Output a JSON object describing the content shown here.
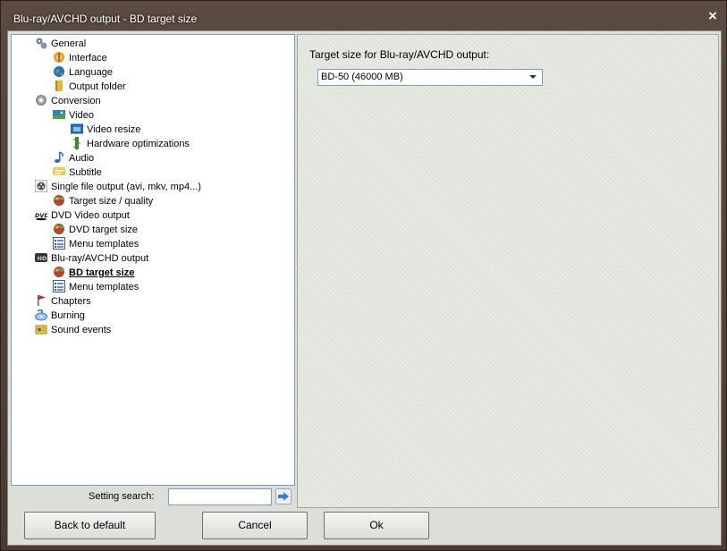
{
  "window": {
    "title": "Blu-ray/AVCHD output - BD target size",
    "close_label": "×"
  },
  "tree": {
    "items": [
      {
        "label": "General",
        "icon": "wrench-gear-icon"
      },
      {
        "label": "Interface",
        "icon": "interface-icon"
      },
      {
        "label": "Language",
        "icon": "globe-icon"
      },
      {
        "label": "Output folder",
        "icon": "folder-icon"
      },
      {
        "label": "Conversion",
        "icon": "gear-icon"
      },
      {
        "label": "Video",
        "icon": "video-icon"
      },
      {
        "label": "Video resize",
        "icon": "resize-icon"
      },
      {
        "label": "Hardware optimizations",
        "icon": "hardware-icon"
      },
      {
        "label": "Audio",
        "icon": "music-note-icon"
      },
      {
        "label": "Subtitle",
        "icon": "subtitle-icon"
      },
      {
        "label": "Single file output (avi, mkv, mp4...)",
        "icon": "film-reel-icon"
      },
      {
        "label": "Target size / quality",
        "icon": "target-ball-icon"
      },
      {
        "label": "DVD Video output",
        "icon": "dvd-icon"
      },
      {
        "label": "DVD target size",
        "icon": "target-ball-icon"
      },
      {
        "label": "Menu templates",
        "icon": "menu-list-icon"
      },
      {
        "label": "Blu-ray/AVCHD output",
        "icon": "hd-icon"
      },
      {
        "label": "BD target size",
        "icon": "target-ball-icon"
      },
      {
        "label": "Menu templates",
        "icon": "menu-list-icon"
      },
      {
        "label": "Chapters",
        "icon": "flag-icon"
      },
      {
        "label": "Burning",
        "icon": "burn-disc-icon"
      },
      {
        "label": "Sound events",
        "icon": "sound-events-icon"
      }
    ],
    "selected_label": "BD target size"
  },
  "panel": {
    "label": "Target size for Blu-ray/AVCHD output:",
    "dropdown_value": "BD-50 (46000 MB)"
  },
  "search": {
    "label": "Setting search:",
    "value": ""
  },
  "buttons": {
    "back": "Back to default",
    "cancel": "Cancel",
    "ok": "Ok"
  },
  "colors": {
    "accent": "#3c7fd8",
    "window_frame": "#4a3b33",
    "selection_text": "#000000"
  }
}
